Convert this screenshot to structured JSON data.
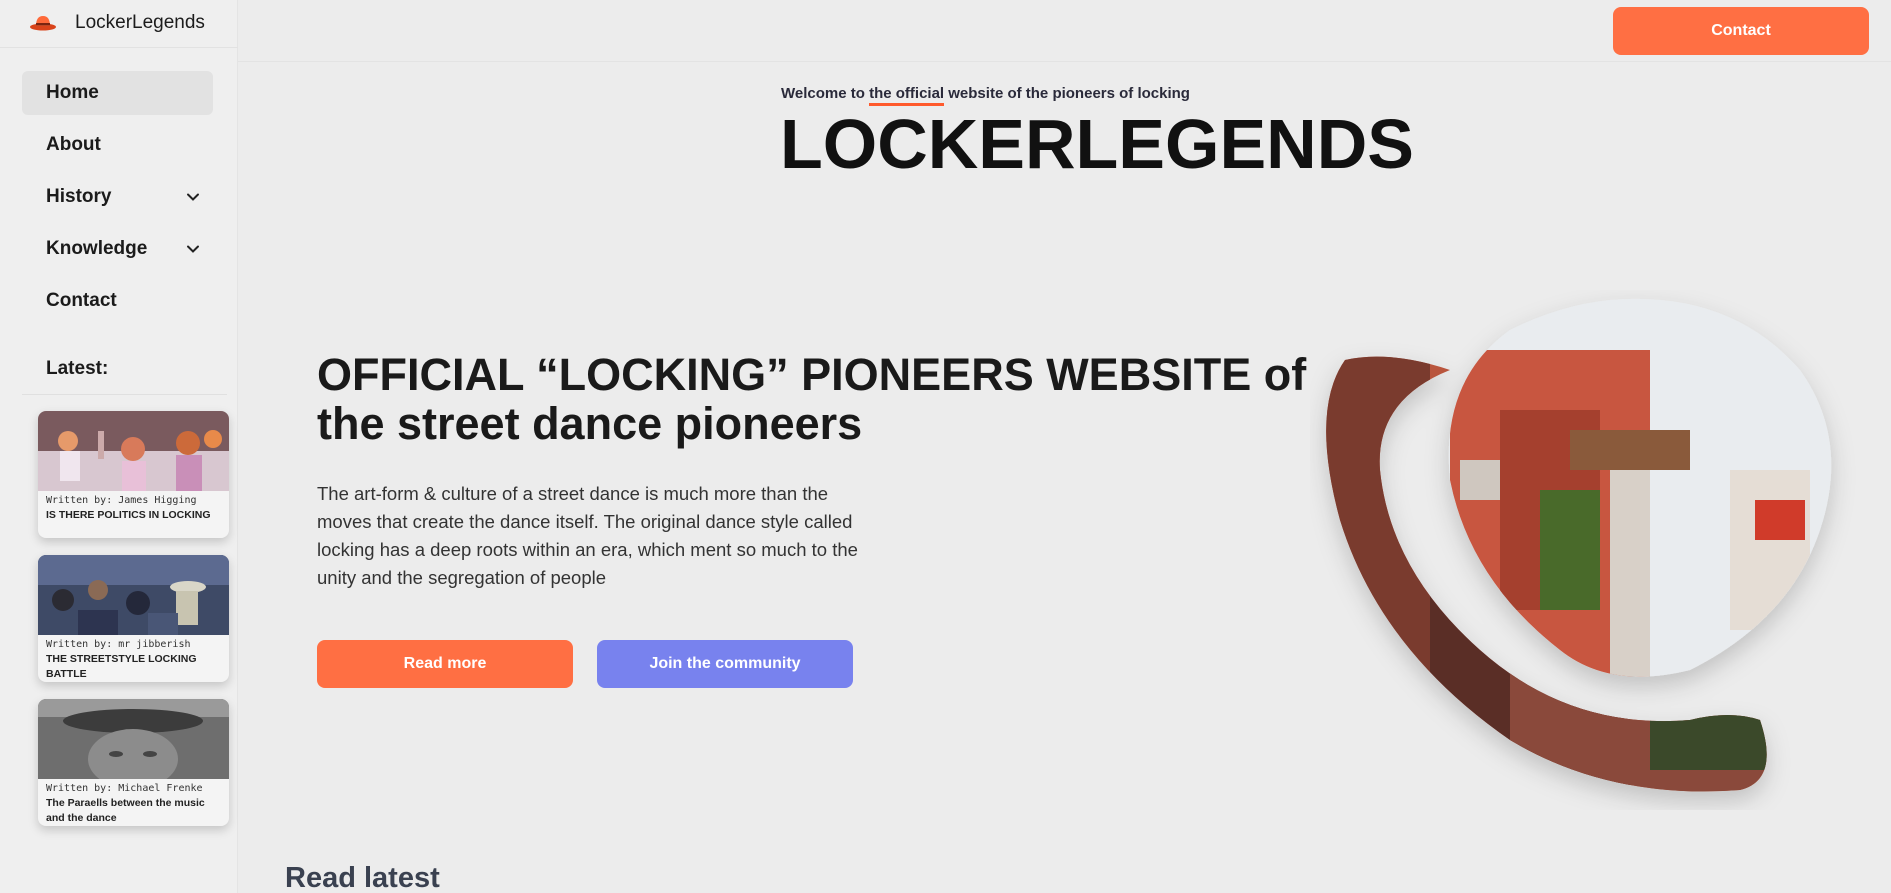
{
  "brand": {
    "name": "LockerLegends"
  },
  "sidebar": {
    "items": [
      {
        "label": "Home",
        "active": true
      },
      {
        "label": "About"
      },
      {
        "label": "History",
        "has_submenu": true
      },
      {
        "label": "Knowledge",
        "has_submenu": true
      },
      {
        "label": "Contact"
      }
    ],
    "latest_label": "Latest:",
    "latest": [
      {
        "author": "Written by: James Higging",
        "title": "IS THERE POLITICS IN LOCKING"
      },
      {
        "author": "Written by: mr jibberish",
        "title": "THE STREETSTYLE LOCKING BATTLE"
      },
      {
        "author": "Written by: Michael Frenke",
        "title": "The Paraells between the music and the dance"
      }
    ]
  },
  "topbar": {
    "contact_label": "Contact"
  },
  "header": {
    "welcome_prefix": "Welcome to ",
    "welcome_highlight": "the official",
    "welcome_suffix": " website of the pioneers of locking",
    "title": "LOCKERLEGENDS"
  },
  "hero": {
    "title": "OFFICIAL “LOCKING” PIONEERS WEBSITE of the street dance pioneers",
    "text": "The art-form & culture of a street dance is much more than the moves that create the dance itself. The original dance style called locking has a deep roots within an era, which ment so much to the unity and the segregation of people",
    "read_more": "Read more",
    "join": "Join the community"
  },
  "section": {
    "read_latest": "Read latest"
  },
  "colors": {
    "accent": "#ff6f43",
    "secondary": "#7882ee",
    "underline": "#ff5a2c"
  },
  "icons": {
    "logo": "hat-icon",
    "chevron": "chevron-down-icon"
  }
}
